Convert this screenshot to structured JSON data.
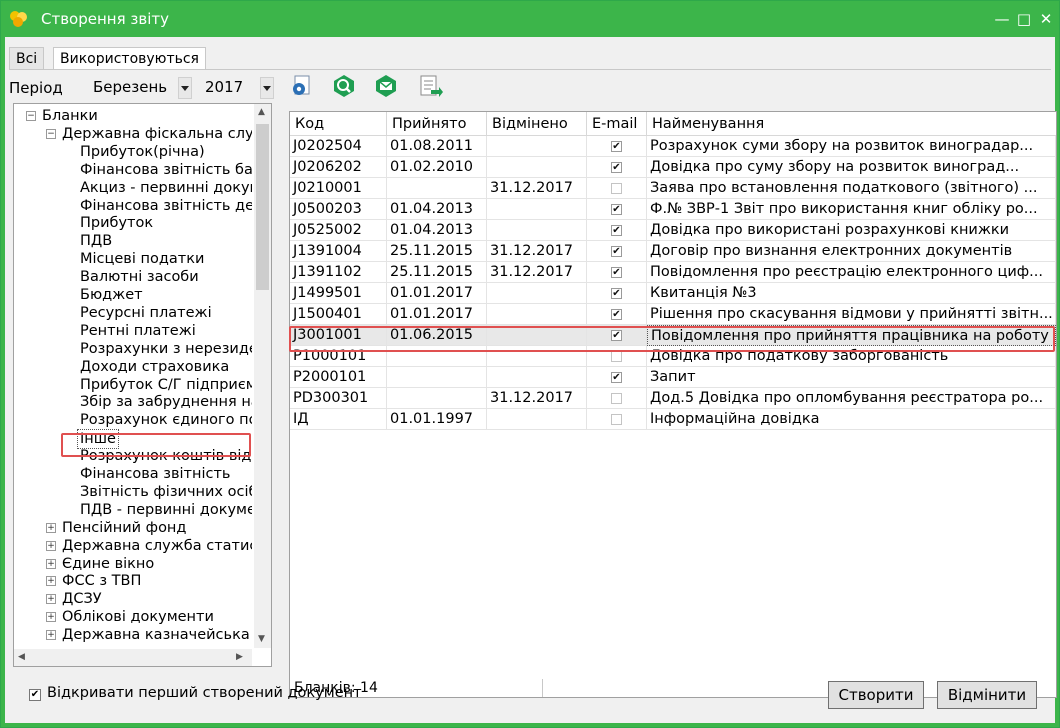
{
  "window": {
    "title": "Створення звіту"
  },
  "tabs": [
    {
      "label": "Всі"
    },
    {
      "label": "Використовуються"
    }
  ],
  "period": {
    "label": "Період",
    "month": "Березень",
    "year": "2017"
  },
  "tree": [
    {
      "label": "Бланки",
      "level": 0,
      "expander": "minus"
    },
    {
      "label": "Державна фіскальна служба",
      "level": 1,
      "expander": "minus"
    },
    {
      "label": "Прибуток(річна)",
      "level": 2
    },
    {
      "label": "Фінансова звітність банків",
      "level": 2
    },
    {
      "label": "Акциз - первинні документи",
      "level": 2
    },
    {
      "label": "Фінансова звітність державних",
      "level": 2
    },
    {
      "label": "Прибуток",
      "level": 2
    },
    {
      "label": "ПДВ",
      "level": 2
    },
    {
      "label": "Місцеві податки",
      "level": 2
    },
    {
      "label": "Валютні засоби",
      "level": 2
    },
    {
      "label": "Бюджет",
      "level": 2
    },
    {
      "label": "Ресурсні платежі",
      "level": 2
    },
    {
      "label": "Рентні платежі",
      "level": 2
    },
    {
      "label": "Розрахунки з нерезидентами",
      "level": 2
    },
    {
      "label": "Доходи страховика",
      "level": 2
    },
    {
      "label": "Прибуток С/Г підприємств",
      "level": 2
    },
    {
      "label": "Збір за забруднення навколишнього",
      "level": 2
    },
    {
      "label": "Розрахунок єдиного податку",
      "level": 2
    },
    {
      "label": "Інше",
      "level": 2,
      "selected": true
    },
    {
      "label": "Розрахунок коштів від",
      "level": 2
    },
    {
      "label": "Фінансова звітність",
      "level": 2
    },
    {
      "label": "Звітність фізичних осіб",
      "level": 2
    },
    {
      "label": "ПДВ - первинні документи",
      "level": 2
    },
    {
      "label": "Пенсійний фонд",
      "level": 1,
      "expander": "plus"
    },
    {
      "label": "Державна служба статистики",
      "level": 1,
      "expander": "plus"
    },
    {
      "label": "Єдине вікно",
      "level": 1,
      "expander": "plus"
    },
    {
      "label": "ФСС з ТВП",
      "level": 1,
      "expander": "plus"
    },
    {
      "label": "ДСЗУ",
      "level": 1,
      "expander": "plus"
    },
    {
      "label": "Облікові документи",
      "level": 1,
      "expander": "plus"
    },
    {
      "label": "Державна казначейська служба",
      "level": 1,
      "expander": "plus"
    }
  ],
  "grid": {
    "columns": [
      "Код",
      "Прийнято",
      "Відмінено",
      "E-mail",
      "Найменування"
    ],
    "rows": [
      {
        "code": "J0202504",
        "accepted": "01.08.2011",
        "cancelled": "",
        "email": true,
        "name": " Розрахунок суми збору на розвиток виноградар..."
      },
      {
        "code": "J0206202",
        "accepted": "01.02.2010",
        "cancelled": "",
        "email": true,
        "name": " Довідка про суму збору на розвиток виноград..."
      },
      {
        "code": "J0210001",
        "accepted": "",
        "cancelled": "31.12.2017",
        "email": false,
        "name": "Заява про встановлення податкового (звітного) ..."
      },
      {
        "code": "J0500203",
        "accepted": "01.04.2013",
        "cancelled": "",
        "email": true,
        "name": "Ф.№ ЗВР-1 Звіт про використання книг обліку ро..."
      },
      {
        "code": "J0525002",
        "accepted": "01.04.2013",
        "cancelled": "",
        "email": true,
        "name": "Довідка про використані розрахункові книжки"
      },
      {
        "code": "J1391004",
        "accepted": "25.11.2015",
        "cancelled": "31.12.2017",
        "email": true,
        "name": "Договір про визнання електронних документів"
      },
      {
        "code": "J1391102",
        "accepted": "25.11.2015",
        "cancelled": "31.12.2017",
        "email": true,
        "name": "Повідомлення про реєстрацію електронного циф..."
      },
      {
        "code": "J1499501",
        "accepted": "01.01.2017",
        "cancelled": "",
        "email": true,
        "name": "Квитанція №3"
      },
      {
        "code": "J1500401",
        "accepted": "01.01.2017",
        "cancelled": "",
        "email": true,
        "name": "Рішення про скасування відмови у прийнятті звітн..."
      },
      {
        "code": "J3001001",
        "accepted": "01.06.2015",
        "cancelled": "",
        "email": true,
        "name": "Повідомлення про прийняття працівника на роботу",
        "selected": true
      },
      {
        "code": "P1000101",
        "accepted": "",
        "cancelled": "",
        "email": false,
        "name": "Довідка про податкову заборгованість"
      },
      {
        "code": "P2000101",
        "accepted": "",
        "cancelled": "",
        "email": true,
        "name": "Запит"
      },
      {
        "code": "PD300301",
        "accepted": "",
        "cancelled": "31.12.2017",
        "email": false,
        "name": "Дод.5 Довідка про опломбування реєстратора ро..."
      },
      {
        "code": "ІД",
        "accepted": "01.01.1997",
        "cancelled": "",
        "email": false,
        "name": "Інформаційна довідка"
      }
    ],
    "footer": "Бланків: 14"
  },
  "bottom": {
    "open_first_label": "Відкривати перший створений документ",
    "open_first_checked": true,
    "create_label": "Створити",
    "cancel_label": "Відмінити"
  },
  "colors": {
    "titlebar": "#3cb54a",
    "highlight": "#e05050",
    "toolbar_icon": "#1f9e52"
  },
  "icons": [
    "app-logo-icon",
    "minimize-icon",
    "maximize-icon",
    "close-icon",
    "settings-doc-icon",
    "search-icon",
    "mail-icon",
    "export-doc-icon"
  ]
}
